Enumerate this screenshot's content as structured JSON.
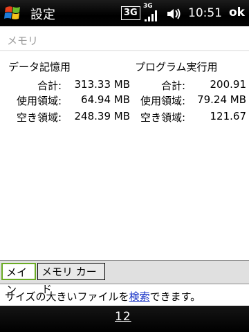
{
  "titlebar": {
    "title": "設定",
    "status_3g": "3G",
    "status_3g_small": "3G",
    "clock": "10:51",
    "ok": "ok"
  },
  "section": {
    "header": "メモリ"
  },
  "memory": {
    "data_storage": {
      "heading": "データ記憶用",
      "rows": [
        {
          "label": "合計:",
          "value": "313.33 MB"
        },
        {
          "label": "使用領域:",
          "value": "64.94 MB"
        },
        {
          "label": "空き領域:",
          "value": "248.39 MB"
        }
      ]
    },
    "program_execution": {
      "heading": "プログラム実行用",
      "rows": [
        {
          "label": "合計:",
          "value": "200.91"
        },
        {
          "label": "使用領域:",
          "value": "79.24 MB"
        },
        {
          "label": "空き領域:",
          "value": "121.67"
        }
      ]
    }
  },
  "tabs": [
    {
      "label": "メイン",
      "active": true
    },
    {
      "label": "メモリ カード",
      "active": false
    }
  ],
  "footer": {
    "text_before": "サイズの大きいファイルを",
    "link": "検索",
    "text_after": "できます。"
  },
  "softkeys": {
    "keyboard": "12"
  }
}
